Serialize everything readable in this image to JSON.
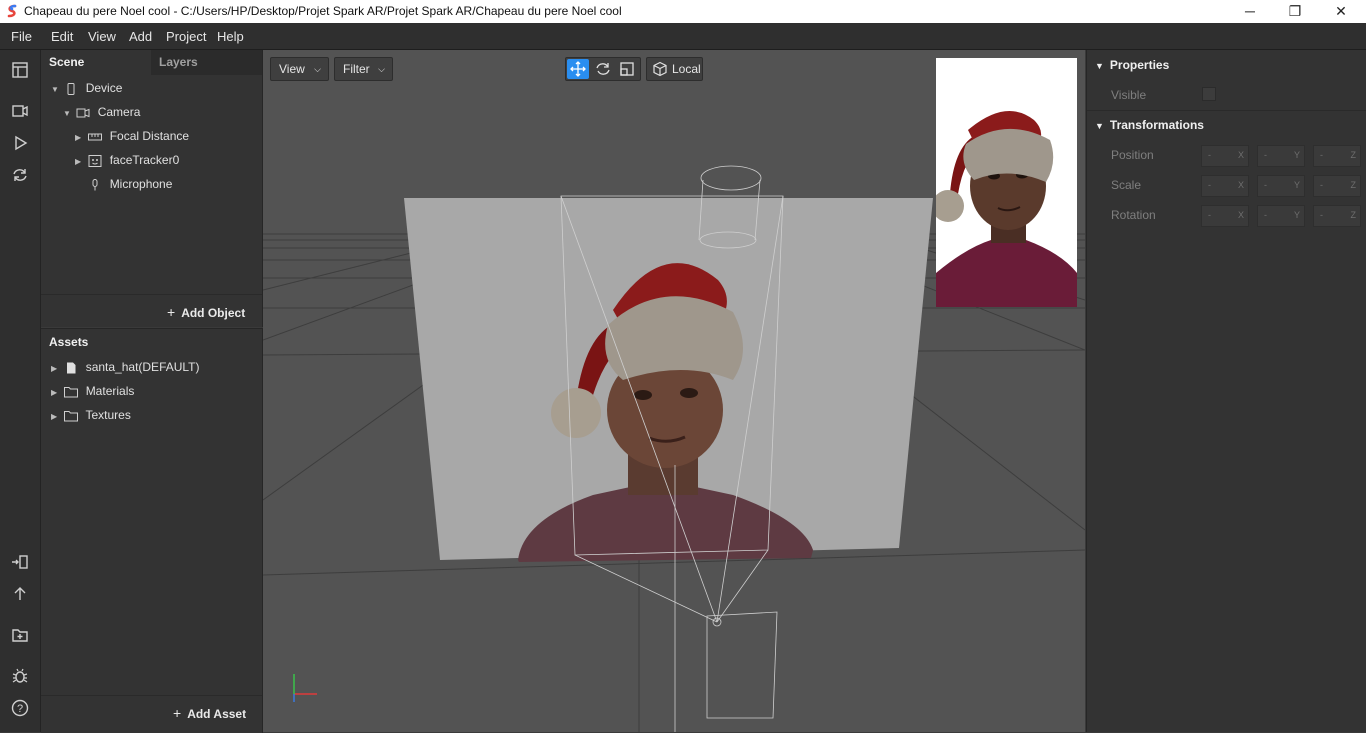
{
  "window": {
    "title": "Chapeau du pere Noel cool - C:/Users/HP/Desktop/Projet Spark AR/Projet Spark AR/Chapeau du pere Noel cool",
    "minimize": "─",
    "restore": "❐",
    "close": "✕"
  },
  "menu": [
    "File",
    "Edit",
    "View",
    "Add",
    "Project",
    "Help"
  ],
  "scene": {
    "tabs": [
      "Scene",
      "Layers"
    ],
    "tree": [
      {
        "label": "Device",
        "icon": "device-icon"
      },
      {
        "label": "Camera",
        "icon": "camera-icon"
      },
      {
        "label": "Focal Distance",
        "icon": "focal-distance-icon"
      },
      {
        "label": "faceTracker0",
        "icon": "face-tracker-icon"
      },
      {
        "label": "Microphone",
        "icon": "microphone-icon"
      }
    ],
    "add_object": "Add Object"
  },
  "assets": {
    "title": "Assets",
    "items": [
      {
        "label": "santa_hat(DEFAULT)",
        "icon": "file-icon"
      },
      {
        "label": "Materials",
        "icon": "folder-icon"
      },
      {
        "label": "Textures",
        "icon": "folder-icon"
      }
    ],
    "add_asset": "Add Asset"
  },
  "viewport": {
    "view_label": "View",
    "filter_label": "Filter",
    "space_label": "Local"
  },
  "properties": {
    "section_properties": "Properties",
    "visible_label": "Visible",
    "section_transform": "Transformations",
    "rows": [
      {
        "label": "Position",
        "values": [
          "-",
          "-",
          "-"
        ]
      },
      {
        "label": "Scale",
        "values": [
          "-",
          "-",
          "-"
        ]
      },
      {
        "label": "Rotation",
        "values": [
          "-",
          "-",
          "-"
        ]
      }
    ],
    "axes": [
      "X",
      "Y",
      "Z"
    ]
  },
  "colors": {
    "accent": "#2a8ef0",
    "hat_red": "#8b1414",
    "fur": "#a39a8e"
  }
}
